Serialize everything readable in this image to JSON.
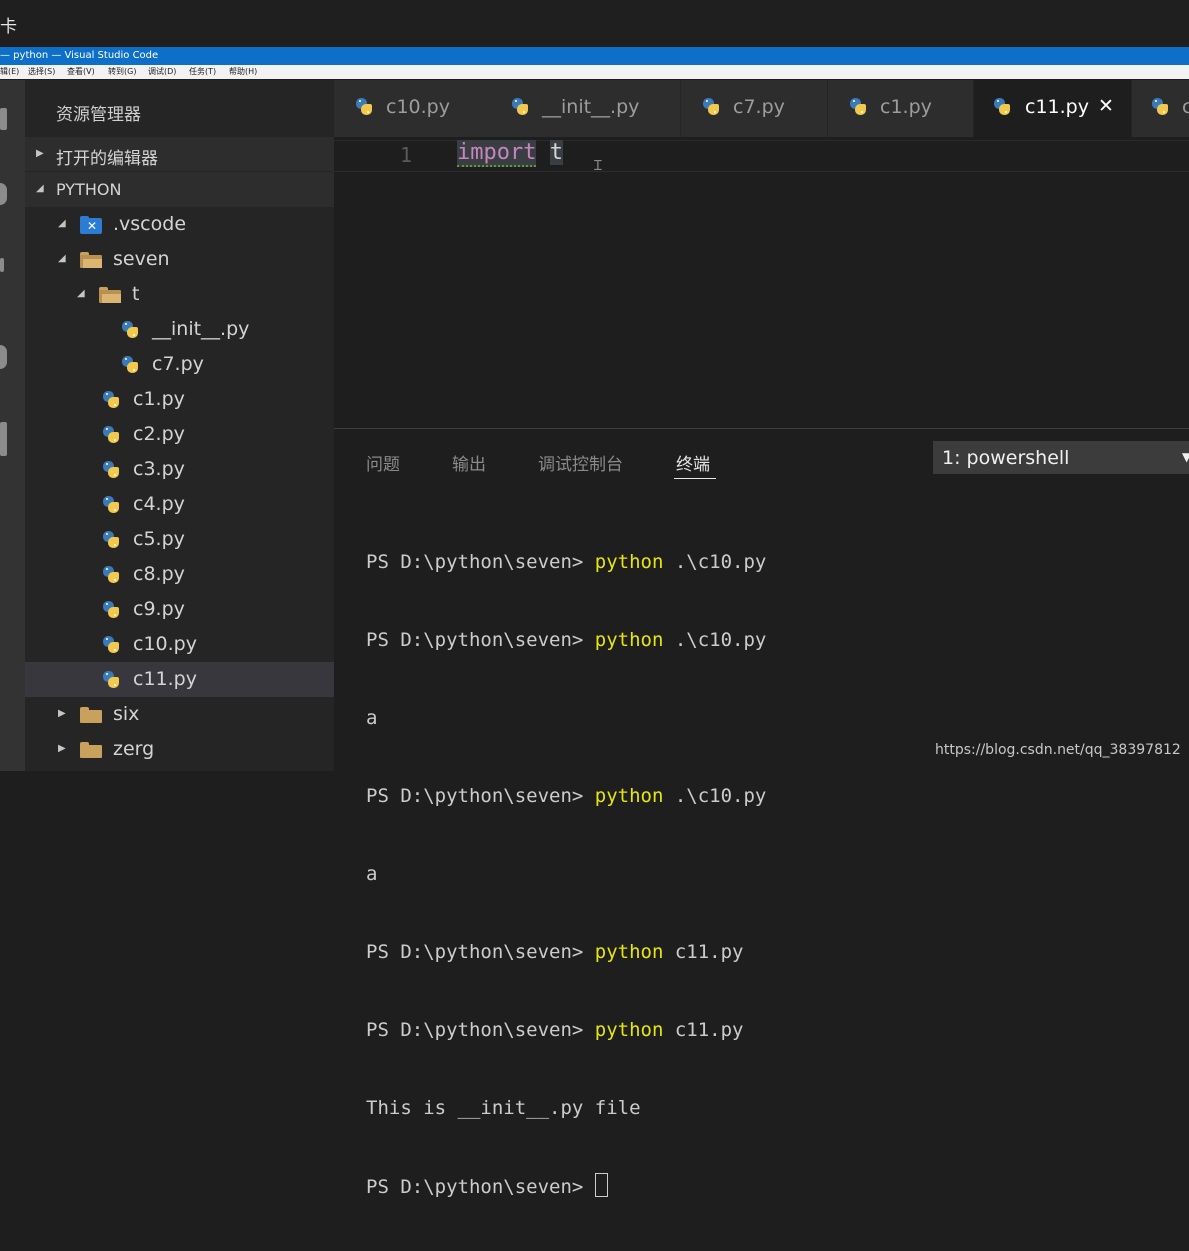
{
  "top_strip": {
    "glyph": "卡"
  },
  "titlebar": {
    "title": "— python — Visual Studio Code"
  },
  "menubar": {
    "items": [
      "编辑(E)",
      "选择(S)",
      "查看(V)",
      "转到(G)",
      "调试(D)",
      "任务(T)",
      "帮助(H)"
    ]
  },
  "sidebar": {
    "title": "资源管理器",
    "open_editors": "打开的编辑器",
    "project": "PYTHON",
    "tree": [
      {
        "label": ".vscode",
        "icon": "vscode-folder-icon"
      },
      {
        "label": "seven",
        "icon": "folder-open-icon"
      },
      {
        "label": "t",
        "icon": "folder-open-icon"
      },
      {
        "label": "__init__.py",
        "icon": "python-file-icon"
      },
      {
        "label": "c7.py",
        "icon": "python-file-icon"
      },
      {
        "label": "c1.py",
        "icon": "python-file-icon"
      },
      {
        "label": "c2.py",
        "icon": "python-file-icon"
      },
      {
        "label": "c3.py",
        "icon": "python-file-icon"
      },
      {
        "label": "c4.py",
        "icon": "python-file-icon"
      },
      {
        "label": "c5.py",
        "icon": "python-file-icon"
      },
      {
        "label": "c8.py",
        "icon": "python-file-icon"
      },
      {
        "label": "c9.py",
        "icon": "python-file-icon"
      },
      {
        "label": "c10.py",
        "icon": "python-file-icon"
      },
      {
        "label": "c11.py",
        "icon": "python-file-icon"
      },
      {
        "label": "six",
        "icon": "folder-icon"
      },
      {
        "label": "zerg",
        "icon": "folder-icon"
      }
    ]
  },
  "tabs": [
    {
      "label": "c10.py"
    },
    {
      "label": "__init__.py"
    },
    {
      "label": "c7.py"
    },
    {
      "label": "c1.py"
    },
    {
      "label": "c11.py",
      "active": true,
      "close": "✕"
    },
    {
      "label": "c"
    }
  ],
  "editor": {
    "line_number": "1",
    "keyword": "import",
    "identifier": "t"
  },
  "panel": {
    "tabs": [
      "问题",
      "输出",
      "调试控制台",
      "终端"
    ],
    "active_tab": "终端",
    "terminal_select": "1: powershell",
    "terminal_lines": [
      {
        "prompt": "PS D:\\python\\seven> ",
        "cmd": "python",
        "args": " .\\c10.py"
      },
      {
        "prompt": "PS D:\\python\\seven> ",
        "cmd": "python",
        "args": " .\\c10.py"
      },
      {
        "prompt": "a",
        "cmd": "",
        "args": ""
      },
      {
        "prompt": "PS D:\\python\\seven> ",
        "cmd": "python",
        "args": " .\\c10.py"
      },
      {
        "prompt": "a",
        "cmd": "",
        "args": ""
      },
      {
        "prompt": "PS D:\\python\\seven> ",
        "cmd": "python",
        "args": " c11.py"
      },
      {
        "prompt": "PS D:\\python\\seven> ",
        "cmd": "python",
        "args": " c11.py"
      },
      {
        "prompt": "This is __init__.py file",
        "cmd": "",
        "args": ""
      },
      {
        "prompt": "PS D:\\python\\seven> ",
        "cmd": "",
        "args": ""
      }
    ]
  },
  "watermark": "https://blog.csdn.net/qq_38397812",
  "colors": {
    "titlebar": "#0d6fc8",
    "keyword": "#c586c0",
    "terminal_cmd": "#e5e510",
    "python_blue": "#3b7ab8",
    "python_yellow": "#f2c94c"
  }
}
